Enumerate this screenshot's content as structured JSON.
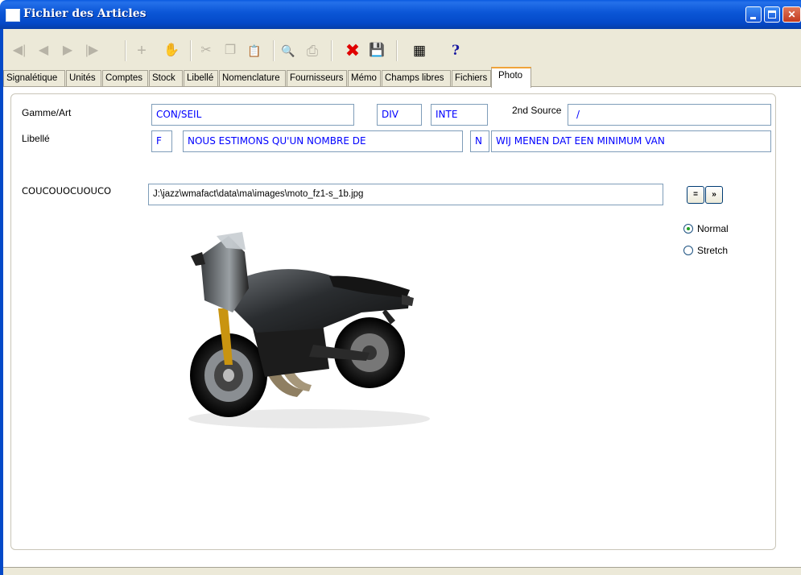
{
  "window": {
    "title": "Fichier des Articles",
    "controls": {
      "minimize": "minimize-icon",
      "maximize": "maximize-icon",
      "close": "✕"
    }
  },
  "toolbar": {
    "buttons": [
      {
        "name": "first-record",
        "glyph": "◀|",
        "enabled": false
      },
      {
        "name": "previous-record",
        "glyph": "◀",
        "enabled": false
      },
      {
        "name": "next-record",
        "glyph": "▶",
        "enabled": false
      },
      {
        "name": "last-record",
        "glyph": "|▶",
        "enabled": false
      },
      {
        "name": "add",
        "glyph": "+",
        "enabled": false
      },
      {
        "name": "delete-hand",
        "glyph": "✋",
        "enabled": false
      },
      {
        "name": "cut",
        "glyph": "✂",
        "enabled": false
      },
      {
        "name": "copy",
        "glyph": "❐",
        "enabled": false
      },
      {
        "name": "paste",
        "glyph": "📋",
        "enabled": false
      },
      {
        "name": "search",
        "glyph": "🔍",
        "enabled": false
      },
      {
        "name": "print",
        "glyph": "⎙",
        "enabled": false
      },
      {
        "name": "cancel",
        "glyph": "✖",
        "enabled": true
      },
      {
        "name": "save",
        "glyph": "💾",
        "enabled": true
      },
      {
        "name": "exit",
        "glyph": "▦",
        "enabled": true
      },
      {
        "name": "help",
        "glyph": "?",
        "enabled": true
      }
    ],
    "colors": {
      "cancel": "#e00000",
      "help": "#1a1aa0"
    }
  },
  "tabs": [
    {
      "label": "Signalétique"
    },
    {
      "label": "Unités"
    },
    {
      "label": "Comptes"
    },
    {
      "label": "Stock"
    },
    {
      "label": "Libellé"
    },
    {
      "label": "Nomenclature"
    },
    {
      "label": "Fournisseurs"
    },
    {
      "label": "Mémo"
    },
    {
      "label": "Champs libres"
    },
    {
      "label": "Fichiers"
    },
    {
      "label": "Photo",
      "selected": true
    }
  ],
  "article": {
    "gamme_label": "Gamme/Art",
    "gamme": "CON/SEIL",
    "code1": "DIV",
    "code2": "INTE",
    "second_source_label": "2nd Source",
    "second_source": "/",
    "libelle_label": "Libellé",
    "lang1": "F",
    "libelle1": "NOUS ESTIMONS QU'UN NOMBRE DE",
    "lang2": "N",
    "libelle2": "WIJ MENEN DAT EEN MINIMUM VAN"
  },
  "photo": {
    "label": "COUCOUOCUOUCO",
    "path": "J:\\jazz\\wmafact\\data\\ma\\images\\moto_fz1-s_1b.jpg",
    "btn_equal": "=",
    "btn_browse": "»",
    "mode_options": [
      {
        "label": "Normal",
        "checked": true
      },
      {
        "label": "Stretch",
        "checked": false
      }
    ]
  }
}
